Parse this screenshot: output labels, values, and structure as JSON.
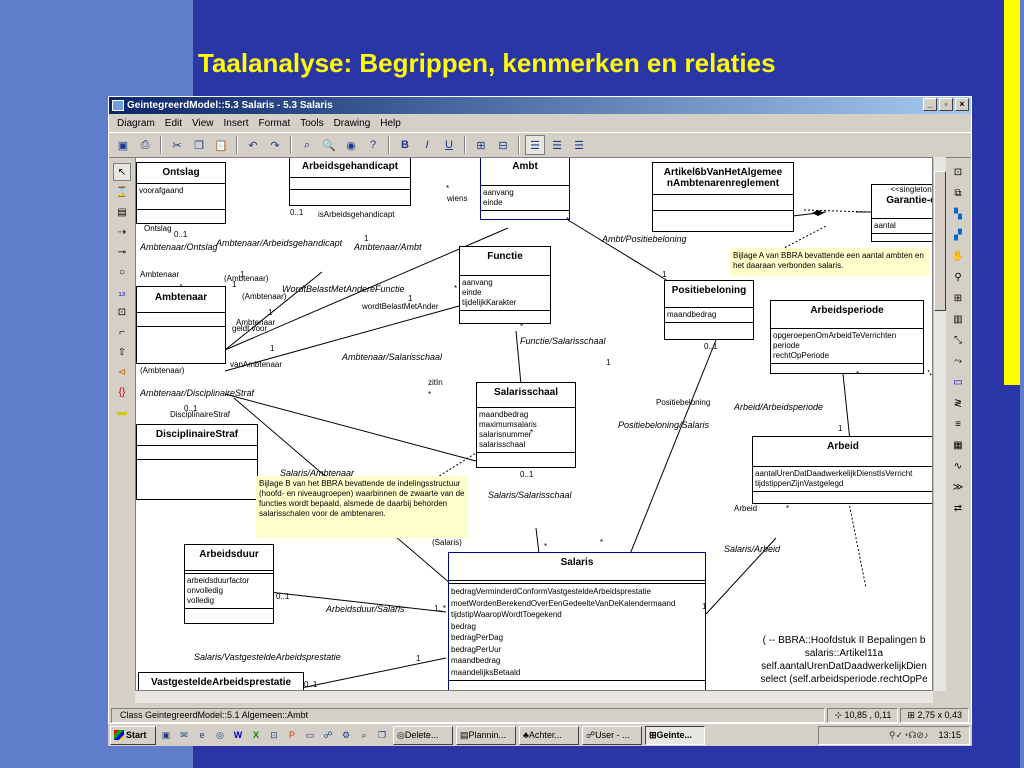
{
  "slide": {
    "title": "Taalanalyse: Begrippen, kenmerken en relaties"
  },
  "window": {
    "title": "GeintegreerdModel::5.3 Salaris - 5.3 Salaris",
    "buttons": {
      "minimize": "_",
      "maximize": "▫",
      "close": "×"
    }
  },
  "menubar": [
    "Diagram",
    "Edit",
    "View",
    "Insert",
    "Format",
    "Tools",
    "Drawing",
    "Help"
  ],
  "toolbar": [
    "save-icon",
    "print-icon",
    "cut-icon",
    "copy-icon",
    "paste-icon",
    "undo-icon",
    "redo-icon",
    "browse-icon",
    "zoom-icon",
    "view-icon",
    "help-icon",
    "bold-icon",
    "italic-icon",
    "underline-icon",
    "layout-icon",
    "layout2-icon",
    "align-left-icon",
    "align-center-icon",
    "align-right-icon"
  ],
  "classes": {
    "ontslag": {
      "name": "Ontslag",
      "attrs": [
        "voorafgaand"
      ]
    },
    "arbeidsgehandicapt": {
      "name": "Arbeidsgehandicapt",
      "attrs": []
    },
    "ambt": {
      "name": "Ambt",
      "attrs": [
        "aanvang",
        "einde"
      ]
    },
    "artikel6b": {
      "name": "Artikel6bVanHetAlgemee nAmbtenarenreglement",
      "attrs": []
    },
    "garantie": {
      "stereo": "<<singleton",
      "name": "Garantie-c",
      "attrs": [
        "aantal"
      ]
    },
    "functie": {
      "name": "Functie",
      "attrs": [
        "aanvang",
        "einde",
        "tijdelijkKarakter"
      ]
    },
    "ambtenaar": {
      "name": "Ambtenaar",
      "attrs": []
    },
    "positiebeloning": {
      "name": "Positiebeloning",
      "attrs": [
        "maandbedrag"
      ]
    },
    "arbeidsperiode": {
      "name": "Arbeidsperiode",
      "attrs": [
        "opgeroepenOmArbeidTeVerrichten",
        "periode",
        "rechtOpPeriode"
      ]
    },
    "salarisschaal": {
      "name": "Salarisschaal",
      "attrs": [
        "maandbedrag",
        "maximumsalaris",
        "salarisnummer",
        "salarisschaal"
      ]
    },
    "disciplinairestraf": {
      "name": "DisciplinaireStraf",
      "attrs": []
    },
    "arbeid": {
      "name": "Arbeid",
      "attrs": [
        "aantalUrenDatDaadwerkelijkDienstIsVerricht",
        "tijdstippenZijnVastgelegd"
      ]
    },
    "arbeidsduur": {
      "name": "Arbeidsduur",
      "attrs": [
        "arbeidsduurfactor",
        "onvolledig",
        "volledig"
      ]
    },
    "salaris": {
      "name": "Salaris",
      "attrs": [
        "bedragVerminderdConformVastgesteldeArbeidsprestatie",
        "moetWordenBerekendOverEenGedeelteVanDeKalendermaand",
        "tijdstipWaaropWordtToegekend",
        "bedrag",
        "bedragPerDag",
        "bedragPerUur",
        "maandbedrag",
        "maandelijksBetaald"
      ]
    },
    "vastgesteldearbeidsprestatie": {
      "name": "VastgesteldeArbeidsprestatie",
      "attrs": []
    }
  },
  "notes": {
    "bijlage_a": "Bijlage A van BBRA bevattende een aantal ambten en het daaraan verbonden salaris.",
    "bijlage_b": "Bijlage B van het BBRA bevattende de indelingsstructuur (hoofd- en niveaugroepen) waarbinnen de zwaarte van de functies wordt bepaald, alsmede de daarbij behorden salarisschalen voor de ambtenaren."
  },
  "association_labels": {
    "ambtenaar_ontslag": "Ambtenaar/Ontslag",
    "ambtenaar_arbeidsgehandicapt": "Ambtenaar/Arbeidsgehandicapt",
    "ambtenaar_ambt": "Ambtenaar/Ambt",
    "ambt_positiebeloning": "Ambt/Positiebeloning",
    "wordtbelast": "WordtBelastMetAndereFunctie",
    "functie_salarisschaal": "Functie/Salarisschaal",
    "ambtenaar_salarisschaal": "Ambtenaar/Salarisschaal",
    "ambtenaar_disciplinairestraf": "Ambtenaar/DisciplinaireStraf",
    "arbeid_arbeidsperiode": "Arbeid/Arbeidsperiode",
    "positiebeloning_salaris": "Positiebeloning/Salaris",
    "salaris_salarisschaal": "Salaris/Salarisschaal",
    "salaris_arbeid": "Salaris/Arbeid",
    "arbeidsduur_salaris": "Arbeidsduur/Salaris",
    "salaris_vastgesteldearbeidsprestatie": "Salaris/VastgesteldeArbeidsprestatie",
    "salaris_ambtenaar": "Salaris/Ambtenaar"
  },
  "role_labels": {
    "ontslag": "Ontslag",
    "isarbeidsgehandicapt": "isArbeidsgehandicapt",
    "wiens": "wiens",
    "ambtenaar1": "Ambtenaar",
    "ambtenaar_p1": "(Ambtenaar)",
    "ambtenaar_p2": "(Ambtenaar)",
    "ambtenaar2": "Ambtenaar",
    "geldtvoor": "geldt voor",
    "wordtbelastmetander": "wordtBelastMetAnder",
    "vanambtenaar": "vanAmbtenaar",
    "ambtenaar_p3": "(Ambtenaar)",
    "disciplinairestraf": "DisciplinaireStraf",
    "zitin": "zitIn",
    "positiebeloning": "Positiebeloning",
    "arbeid": "Arbeid",
    "salaris_p": "(Salaris)"
  },
  "multiplicities": {
    "m1": "0..1",
    "m2": "1",
    "m3": "*",
    "m4": "0..1",
    "m5": "1",
    "m6": "1",
    "m7": "*",
    "m8": "1",
    "m9": "*",
    "m10": "1",
    "m11": "1",
    "m12": "0..1",
    "m13": "1",
    "m14": "*",
    "m15": "0..1",
    "m16": "*",
    "m17": "1",
    "m18": "*",
    "m19": "*",
    "m20": "0..1",
    "m21": "1..*",
    "m22": "1",
    "m23": "0..1",
    "m24": "1",
    "m25": "0..1",
    "m26": "*",
    "m27": "1",
    "m28": "*",
    "m29": "*"
  },
  "ocl": {
    "line1": "( -- BBRA::Hoofdstuk II Bepalingen b",
    "line2": "salaris::Artikel11a",
    "line3": "self.aantalUrenDatDaadwerkelijkDien",
    "line4": "select (self.arbeidsperiode.rechtOpPe"
  },
  "statusbar": {
    "message": "Class GeintegreerdModel::5.1 Algemeen::Ambt",
    "coords": "10,85 , 0,11",
    "size": "2,75 x 0,43"
  },
  "taskbar": {
    "start": "Start",
    "tasks": [
      "Delete...",
      "Plannin...",
      "Achter...",
      "User - ...",
      "Geinte..."
    ],
    "clock": "13:15"
  },
  "colors": {
    "background": "#2a35a6",
    "accent_panel": "#5f7ec9",
    "title": "#ffff00",
    "note": "#ffffcc"
  }
}
